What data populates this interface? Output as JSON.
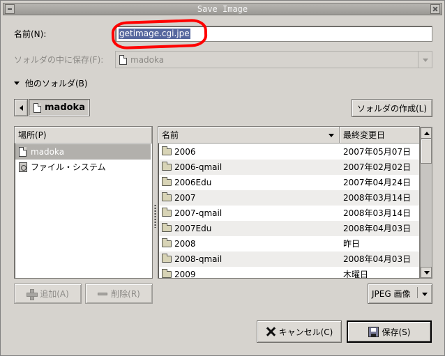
{
  "window": {
    "title": "Save Image"
  },
  "name_row": {
    "label": "名前(N):",
    "value": "getimage.cgi.jpe"
  },
  "save_in_row": {
    "label": "ソォルダの中に保存(F):",
    "value": "madoka"
  },
  "other_folders": {
    "label": "他のソォルダ(B)"
  },
  "path_bar": {
    "current": "madoka",
    "create_folder_label": "ソォルダの作成(L)"
  },
  "places": {
    "header": "場所(P)",
    "items": [
      {
        "label": "madoka",
        "icon": "home-folder-icon",
        "selected": true
      },
      {
        "label": "ファイル・システム",
        "icon": "filesystem-drive-icon",
        "selected": false
      }
    ]
  },
  "files": {
    "col_name": "名前",
    "col_modified": "最終変更日",
    "rows": [
      {
        "name": "2006",
        "date": "2007年05月07日"
      },
      {
        "name": "2006-qmail",
        "date": "2007年02月02日"
      },
      {
        "name": "2006Edu",
        "date": "2007年04月24日"
      },
      {
        "name": "2007",
        "date": "2008年03月14日"
      },
      {
        "name": "2007-qmail",
        "date": "2008年03月14日"
      },
      {
        "name": "2007Edu",
        "date": "2008年04月03日"
      },
      {
        "name": "2008",
        "date": "昨日"
      },
      {
        "name": "2008-qmail",
        "date": "2008年04月03日"
      },
      {
        "name": "2009",
        "date": "木曜日"
      }
    ]
  },
  "buttons": {
    "add": "追加(A)",
    "remove": "削除(R)",
    "filter": "JPEG 画像",
    "cancel": "キャンセル(C)",
    "save": "保存(S)"
  },
  "colors": {
    "selection": "#56679e",
    "annotation": "#ff0000",
    "background": "#d6d3ce"
  }
}
